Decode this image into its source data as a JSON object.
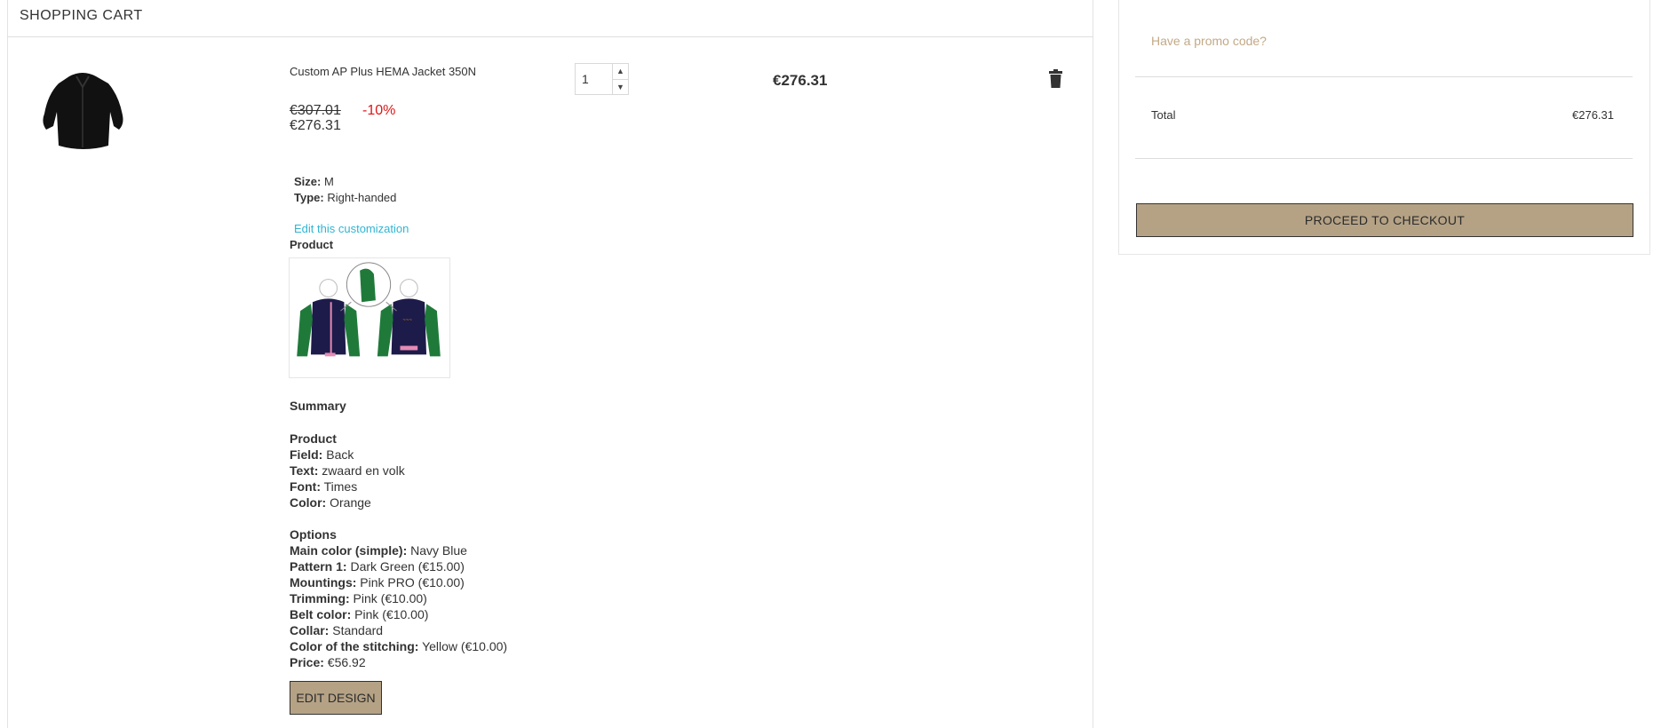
{
  "cart": {
    "title": "SHOPPING CART",
    "item": {
      "name": "Custom AP Plus HEMA Jacket 350N",
      "old_price": "€307.01",
      "discount": "-10%",
      "price": "€276.31",
      "quantity": "1",
      "line_total": "€276.31",
      "attributes": {
        "size_label": "Size:",
        "size_value": " M",
        "type_label": "Type:",
        "type_value": " Right-handed"
      },
      "edit_customization": "Edit this customization",
      "product_heading": "Product",
      "summary": {
        "heading": "Summary",
        "product_section": "Product",
        "product_lines": [
          {
            "label": "Field:",
            "value": " Back"
          },
          {
            "label": "Text:",
            "value": " zwaard en volk"
          },
          {
            "label": "Font:",
            "value": " Times"
          },
          {
            "label": "Color:",
            "value": " Orange"
          }
        ],
        "options_section": "Options",
        "option_lines": [
          {
            "label": "Main color (simple):",
            "value": " Navy Blue"
          },
          {
            "label": "Pattern 1:",
            "value": " Dark Green (€15.00)"
          },
          {
            "label": "Mountings:",
            "value": " Pink PRO (€10.00)"
          },
          {
            "label": "Trimming:",
            "value": " Pink (€10.00)"
          },
          {
            "label": "Belt color:",
            "value": " Pink (€10.00)"
          },
          {
            "label": "Collar:",
            "value": " Standard"
          },
          {
            "label": "Color of the stitching:",
            "value": " Yellow (€10.00)"
          },
          {
            "label": "Price:",
            "value": " €56.92"
          }
        ]
      },
      "edit_design": "EDIT DESIGN"
    }
  },
  "summary_panel": {
    "promo": "Have a promo code?",
    "total_label": "Total",
    "total_value": "€276.31",
    "checkout": "PROCEED TO CHECKOUT"
  },
  "colors": {
    "accent": "#b5a285",
    "link": "#2fb5d2",
    "promo": "#c2a986",
    "discount": "#e01515",
    "jacket_navy": "#1d1b4a",
    "jacket_green": "#1f7a3a",
    "trim_pink": "#e58bb5"
  },
  "icons": {
    "delete": "trash-icon",
    "qty_up": "chevron-up-icon",
    "qty_down": "chevron-down-icon"
  }
}
